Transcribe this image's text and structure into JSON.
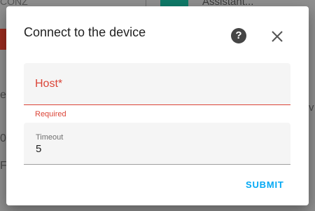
{
  "background": {
    "top_left_text": "CONZ",
    "top_right_text": "Assistant...",
    "left_fragments": [
      "e",
      "0",
      "F"
    ],
    "right_fragment": "rv"
  },
  "dialog": {
    "title": "Connect to the device",
    "help_icon": "help-circle-icon",
    "help_glyph": "?",
    "close_icon": "close-icon",
    "host": {
      "label": "Host*",
      "value": "",
      "helper": "Required",
      "error_color": "#db4437"
    },
    "timeout": {
      "label": "Timeout",
      "value": "5"
    },
    "submit_label": "SUBMIT",
    "accent_color": "#03a9f4"
  }
}
